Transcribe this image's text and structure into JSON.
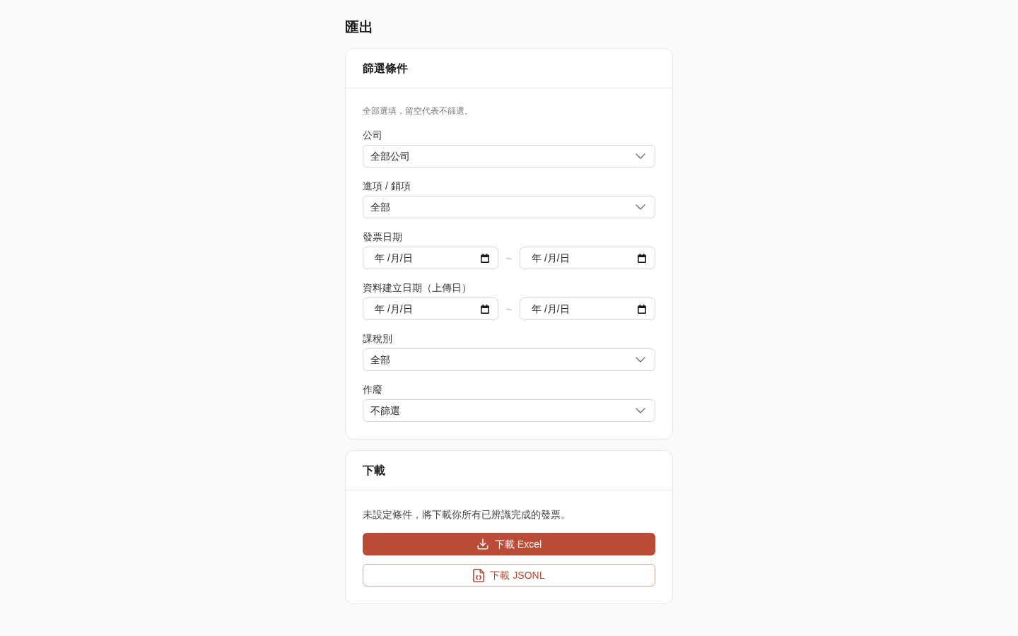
{
  "page_title": "匯出",
  "filter_card": {
    "title": "篩選條件",
    "hint": "全部選填，留空代表不篩選。",
    "fields": [
      {
        "kind": "select",
        "label": "公司",
        "value": "全部公司"
      },
      {
        "kind": "select",
        "label": "進項 / 銷項",
        "value": "全部"
      },
      {
        "kind": "date_range",
        "label": "發票日期",
        "from": {
          "placeholder": "年 /月/日"
        },
        "separator": "～",
        "to": {
          "placeholder": "年 /月/日"
        }
      },
      {
        "kind": "date_range",
        "label": "資料建立日期（上傳日）",
        "from": {
          "placeholder": "年 /月/日"
        },
        "separator": "～",
        "to": {
          "placeholder": "年 /月/日"
        }
      },
      {
        "kind": "select",
        "label": "課稅別",
        "value": "全部"
      },
      {
        "kind": "select",
        "label": "作廢",
        "value": "不篩選"
      }
    ]
  },
  "download_card": {
    "title": "下載",
    "message": "未設定條件，將下載你所有已辨識完成的發票。",
    "buttons": [
      {
        "kind": "primary",
        "label": "下載 Excel"
      },
      {
        "kind": "outline",
        "label": "下載 JSONL"
      }
    ]
  }
}
